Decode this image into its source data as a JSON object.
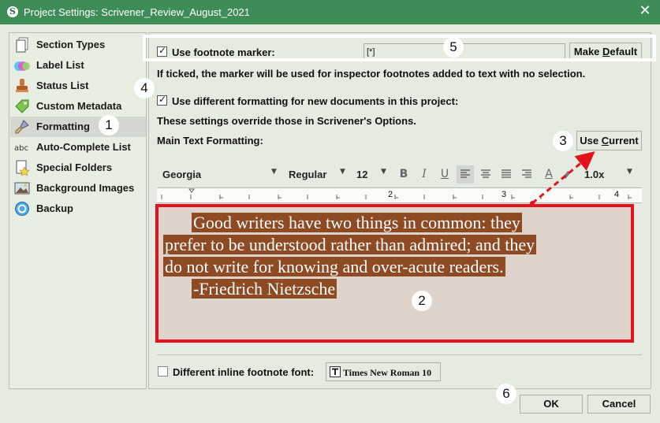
{
  "window": {
    "title": "Project Settings: Scrivener_Review_August_2021",
    "app_icon_letter": "S",
    "close_glyph": "✕"
  },
  "sidebar": {
    "items": [
      {
        "label": "Section Types",
        "icon": "section-types-icon"
      },
      {
        "label": "Label List",
        "icon": "label-list-icon"
      },
      {
        "label": "Status List",
        "icon": "status-stamp-icon"
      },
      {
        "label": "Custom Metadata",
        "icon": "metadata-tag-icon"
      },
      {
        "label": "Formatting",
        "icon": "formatting-brush-icon",
        "selected": true
      },
      {
        "label": "Auto-Complete List",
        "icon": "autocomplete-abc-icon"
      },
      {
        "label": "Special Folders",
        "icon": "special-folders-icon"
      },
      {
        "label": "Background Images",
        "icon": "background-image-icon"
      },
      {
        "label": "Backup",
        "icon": "backup-icon"
      }
    ]
  },
  "formatting": {
    "use_footnote_marker_label": "Use footnote marker:",
    "use_footnote_marker_checked": true,
    "footnote_marker_value": "[*]",
    "make_default_prefix": "Make ",
    "make_default_underlined": "D",
    "make_default_suffix": "efault",
    "marker_hint": "If ticked, the marker will be used for inspector footnotes added to text with no selection.",
    "different_formatting_label": "Use different formatting for new documents in this project:",
    "different_formatting_checked": true,
    "override_note": "These settings override those in Scrivener's Options.",
    "main_text_label": "Main Text Formatting:",
    "use_current_prefix": "Use ",
    "use_current_underlined": "C",
    "use_current_suffix": "urrent",
    "toolbar": {
      "font": "Georgia",
      "style": "Regular",
      "size": "12",
      "bold": "B",
      "italic": "I",
      "underline": "U",
      "text_color": "A",
      "line_spacing": "1.0x"
    },
    "ruler_labels": [
      "1",
      "2",
      "3",
      "4"
    ],
    "sample_lines": [
      "Good writers have two things in common: they",
      "prefer to be understood rather than admired; and they",
      "do not write for knowing and over-acute readers.",
      "-Friedrich Nietzsche"
    ],
    "inline_footnote_label": "Different inline footnote font:",
    "inline_footnote_checked": false,
    "inline_font_button": "Times New Roman 10"
  },
  "footer": {
    "ok": "OK",
    "cancel": "Cancel"
  },
  "annotations": [
    "1",
    "2",
    "3",
    "4",
    "5",
    "6"
  ],
  "colors": {
    "title_bar": "#3e8c58",
    "highlight": "#8e4a22",
    "annotation_red": "#e3121d",
    "editor_bg": "#ded4cc"
  }
}
